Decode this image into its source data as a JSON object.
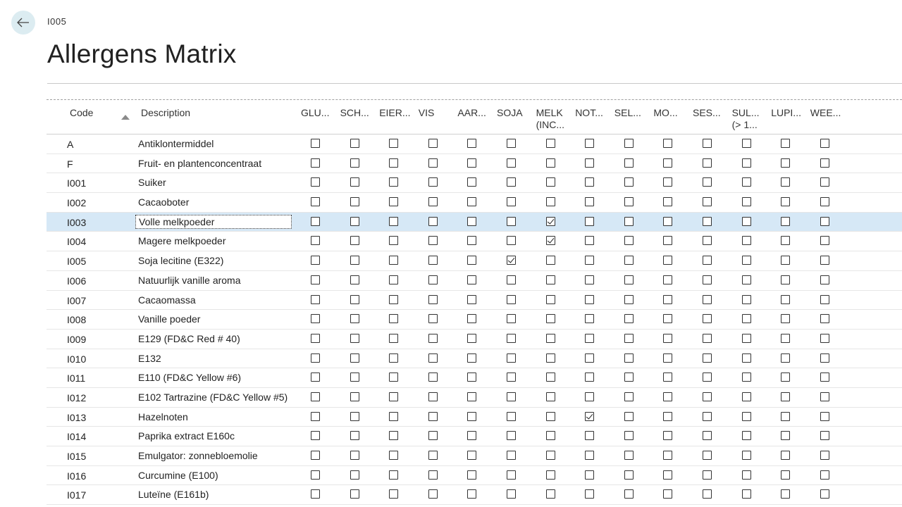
{
  "header": {
    "breadcrumb": "I005",
    "title": "Allergens Matrix"
  },
  "table": {
    "columns": {
      "code": "Code",
      "description": "Description",
      "allergens": [
        [
          "GLU..."
        ],
        [
          "SCH..."
        ],
        [
          "EIER..."
        ],
        [
          "VIS"
        ],
        [
          "AAR..."
        ],
        [
          "SOJA"
        ],
        [
          "MELK",
          "(INC..."
        ],
        [
          "NOT..."
        ],
        [
          "SEL..."
        ],
        [
          "MO..."
        ],
        [
          "SES..."
        ],
        [
          "SUL...",
          "(> 1..."
        ],
        [
          "LUPI..."
        ],
        [
          "WEE..."
        ]
      ]
    },
    "selected_row": 4,
    "rows": [
      {
        "code": "A",
        "description": "Antiklontermiddel",
        "checks": [
          0,
          0,
          0,
          0,
          0,
          0,
          0,
          0,
          0,
          0,
          0,
          0,
          0,
          0
        ]
      },
      {
        "code": "F",
        "description": "Fruit- en plantenconcentraat",
        "checks": [
          0,
          0,
          0,
          0,
          0,
          0,
          0,
          0,
          0,
          0,
          0,
          0,
          0,
          0
        ]
      },
      {
        "code": "I001",
        "description": "Suiker",
        "checks": [
          0,
          0,
          0,
          0,
          0,
          0,
          0,
          0,
          0,
          0,
          0,
          0,
          0,
          0
        ]
      },
      {
        "code": "I002",
        "description": "Cacaoboter",
        "checks": [
          0,
          0,
          0,
          0,
          0,
          0,
          0,
          0,
          0,
          0,
          0,
          0,
          0,
          0
        ]
      },
      {
        "code": "I003",
        "description": "Volle melkpoeder",
        "checks": [
          0,
          0,
          0,
          0,
          0,
          0,
          1,
          0,
          0,
          0,
          0,
          0,
          0,
          0
        ]
      },
      {
        "code": "I004",
        "description": "Magere melkpoeder",
        "checks": [
          0,
          0,
          0,
          0,
          0,
          0,
          1,
          0,
          0,
          0,
          0,
          0,
          0,
          0
        ]
      },
      {
        "code": "I005",
        "description": "Soja lecitine (E322)",
        "checks": [
          0,
          0,
          0,
          0,
          0,
          1,
          0,
          0,
          0,
          0,
          0,
          0,
          0,
          0
        ]
      },
      {
        "code": "I006",
        "description": "Natuurlijk vanille aroma",
        "checks": [
          0,
          0,
          0,
          0,
          0,
          0,
          0,
          0,
          0,
          0,
          0,
          0,
          0,
          0
        ]
      },
      {
        "code": "I007",
        "description": "Cacaomassa",
        "checks": [
          0,
          0,
          0,
          0,
          0,
          0,
          0,
          0,
          0,
          0,
          0,
          0,
          0,
          0
        ]
      },
      {
        "code": "I008",
        "description": "Vanille poeder",
        "checks": [
          0,
          0,
          0,
          0,
          0,
          0,
          0,
          0,
          0,
          0,
          0,
          0,
          0,
          0
        ]
      },
      {
        "code": "I009",
        "description": "E129 (FD&C Red # 40)",
        "checks": [
          0,
          0,
          0,
          0,
          0,
          0,
          0,
          0,
          0,
          0,
          0,
          0,
          0,
          0
        ]
      },
      {
        "code": "I010",
        "description": "E132",
        "checks": [
          0,
          0,
          0,
          0,
          0,
          0,
          0,
          0,
          0,
          0,
          0,
          0,
          0,
          0
        ]
      },
      {
        "code": "I011",
        "description": "E110 (FD&C Yellow #6)",
        "checks": [
          0,
          0,
          0,
          0,
          0,
          0,
          0,
          0,
          0,
          0,
          0,
          0,
          0,
          0
        ]
      },
      {
        "code": "I012",
        "description": "E102 Tartrazine (FD&C Yellow #5)",
        "checks": [
          0,
          0,
          0,
          0,
          0,
          0,
          0,
          0,
          0,
          0,
          0,
          0,
          0,
          0
        ]
      },
      {
        "code": "I013",
        "description": "Hazelnoten",
        "checks": [
          0,
          0,
          0,
          0,
          0,
          0,
          0,
          1,
          0,
          0,
          0,
          0,
          0,
          0
        ]
      },
      {
        "code": "I014",
        "description": "Paprika extract E160c",
        "checks": [
          0,
          0,
          0,
          0,
          0,
          0,
          0,
          0,
          0,
          0,
          0,
          0,
          0,
          0
        ]
      },
      {
        "code": "I015",
        "description": "Emulgator: zonnebloemolie",
        "checks": [
          0,
          0,
          0,
          0,
          0,
          0,
          0,
          0,
          0,
          0,
          0,
          0,
          0,
          0
        ]
      },
      {
        "code": "I016",
        "description": "Curcumine (E100)",
        "checks": [
          0,
          0,
          0,
          0,
          0,
          0,
          0,
          0,
          0,
          0,
          0,
          0,
          0,
          0
        ]
      },
      {
        "code": "I017",
        "description": "Luteïne (E161b)",
        "checks": [
          0,
          0,
          0,
          0,
          0,
          0,
          0,
          0,
          0,
          0,
          0,
          0,
          0,
          0
        ]
      }
    ]
  },
  "icons": {
    "back": "arrow-left-icon",
    "sort": "sort-ascending-icon"
  },
  "colors": {
    "selected_row": "#d6e8f6",
    "back_button_bg": "#dcecf1"
  }
}
